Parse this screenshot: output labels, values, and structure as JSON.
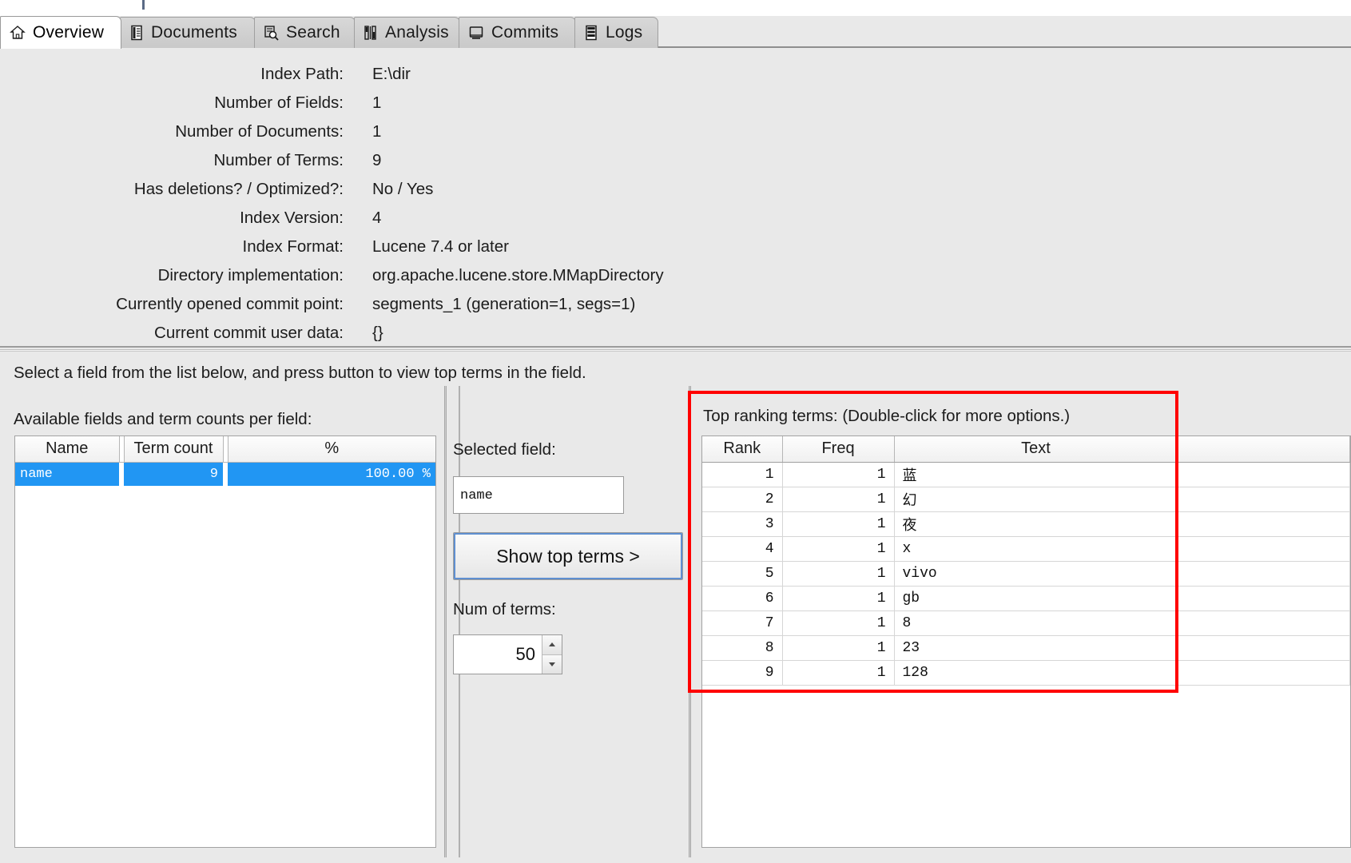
{
  "app": {
    "tabs": [
      {
        "label": "Overview",
        "icon": "home-icon",
        "active": true
      },
      {
        "label": "Documents",
        "icon": "document-icon",
        "active": false
      },
      {
        "label": "Search",
        "icon": "search-icon",
        "active": false
      },
      {
        "label": "Analysis",
        "icon": "analysis-icon",
        "active": false
      },
      {
        "label": "Commits",
        "icon": "commit-icon",
        "active": false
      },
      {
        "label": "Logs",
        "icon": "logs-icon",
        "active": false
      }
    ]
  },
  "overview": {
    "rows": [
      {
        "label": "Index Path:",
        "value": "E:\\dir"
      },
      {
        "label": "Number of Fields:",
        "value": "1"
      },
      {
        "label": "Number of Documents:",
        "value": "1"
      },
      {
        "label": "Number of Terms:",
        "value": "9"
      },
      {
        "label": "Has deletions? / Optimized?:",
        "value": "No / Yes"
      },
      {
        "label": "Index Version:",
        "value": "4"
      },
      {
        "label": "Index Format:",
        "value": "Lucene 7.4 or later"
      },
      {
        "label": "Directory implementation:",
        "value": "org.apache.lucene.store.MMapDirectory"
      },
      {
        "label": "Currently opened commit point:",
        "value": "segments_1 (generation=1, segs=1)"
      },
      {
        "label": "Current commit user data:",
        "value": "{}"
      }
    ]
  },
  "fields_section": {
    "hint": "Select a field from the list below, and press button to view top terms in the field.",
    "available_label": "Available fields and term counts per field:",
    "columns": [
      "Name",
      "Term count",
      "%"
    ],
    "rows": [
      {
        "name": "name",
        "term_count": "9",
        "percent": "100.00 %",
        "selected": true
      }
    ],
    "selection_color": "#2196f3"
  },
  "controls": {
    "selected_field_label": "Selected field:",
    "selected_field_value": "name",
    "show_top_terms_button": "Show top terms >",
    "num_of_terms_label": "Num of terms:",
    "num_of_terms_value": "50",
    "spinner_up_icon": "triangle-up-icon",
    "spinner_down_icon": "triangle-down-icon"
  },
  "top_terms": {
    "title": "Top ranking terms: (Double-click for more options.)",
    "columns": [
      "Rank",
      "Freq",
      "Text"
    ],
    "rows": [
      {
        "rank": "1",
        "freq": "1",
        "text": "蓝"
      },
      {
        "rank": "2",
        "freq": "1",
        "text": "幻"
      },
      {
        "rank": "3",
        "freq": "1",
        "text": "夜"
      },
      {
        "rank": "4",
        "freq": "1",
        "text": "x"
      },
      {
        "rank": "5",
        "freq": "1",
        "text": "vivo"
      },
      {
        "rank": "6",
        "freq": "1",
        "text": "gb"
      },
      {
        "rank": "7",
        "freq": "1",
        "text": "8"
      },
      {
        "rank": "8",
        "freq": "1",
        "text": "23"
      },
      {
        "rank": "9",
        "freq": "1",
        "text": "128"
      }
    ]
  },
  "annotation": {
    "highlight_color": "#ff0000"
  }
}
